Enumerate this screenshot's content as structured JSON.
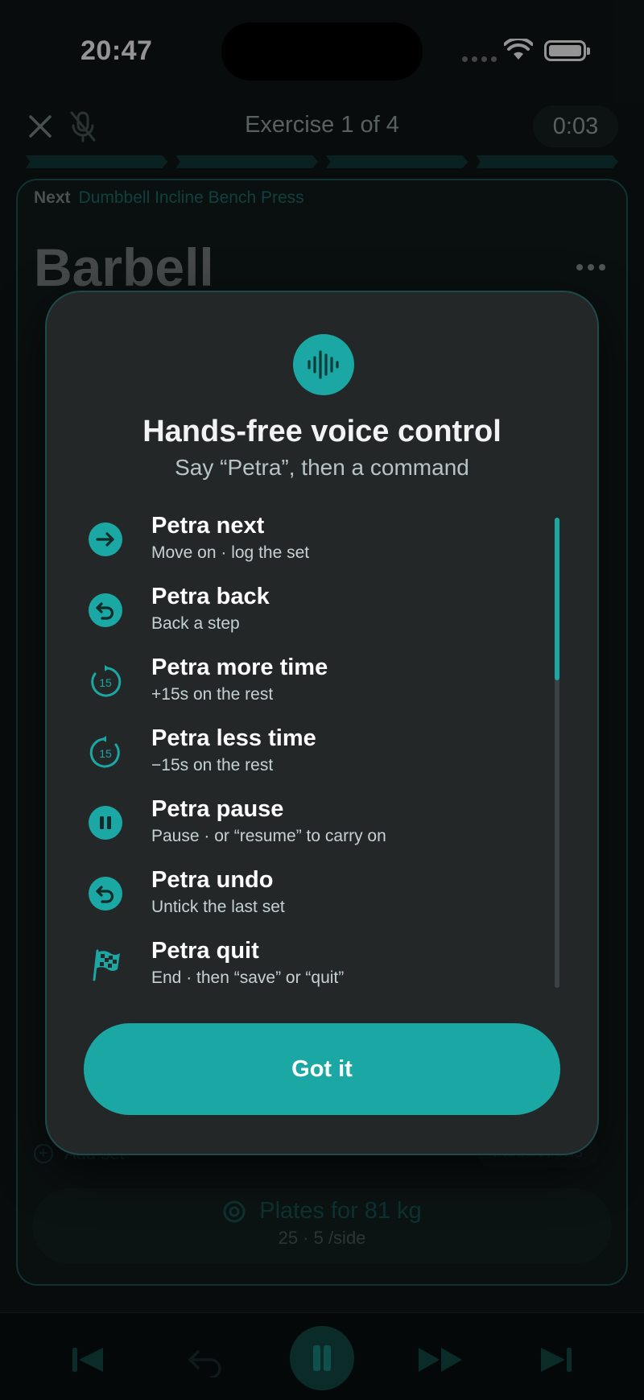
{
  "status": {
    "time": "20:47"
  },
  "topbar": {
    "title": "Exercise 1 of 4",
    "timer": "0:03"
  },
  "card": {
    "next_label": "Next",
    "next_exercise": "Dumbbell Incline Bench Press",
    "exercise_name": "Barbell",
    "add_set": "Add set",
    "instructions": "Instructions",
    "plates_title": "Plates for 81 kg",
    "plates_sub": "25 · 5 /side"
  },
  "modal": {
    "title": "Hands-free voice control",
    "subtitle": "Say “Petra”, then a command",
    "commands": [
      {
        "name": "Petra next",
        "desc": "Move on · log the set",
        "icon": "arrow-right-icon"
      },
      {
        "name": "Petra back",
        "desc": "Back a step",
        "icon": "back-arrow-icon"
      },
      {
        "name": "Petra more time",
        "desc": "+15s on the rest",
        "icon": "forward-15-icon"
      },
      {
        "name": "Petra less time",
        "desc": "−15s on the rest",
        "icon": "rewind-15-icon"
      },
      {
        "name": "Petra pause",
        "desc": "Pause · or “resume” to carry on",
        "icon": "pause-icon"
      },
      {
        "name": "Petra undo",
        "desc": "Untick the last set",
        "icon": "undo-icon"
      },
      {
        "name": "Petra quit",
        "desc": "End · then “save” or “quit”",
        "icon": "checkered-flag-icon"
      }
    ],
    "icon15": "15",
    "button": "Got it"
  },
  "colors": {
    "accent": "#1ba7a3",
    "modal_bg": "#232728"
  }
}
